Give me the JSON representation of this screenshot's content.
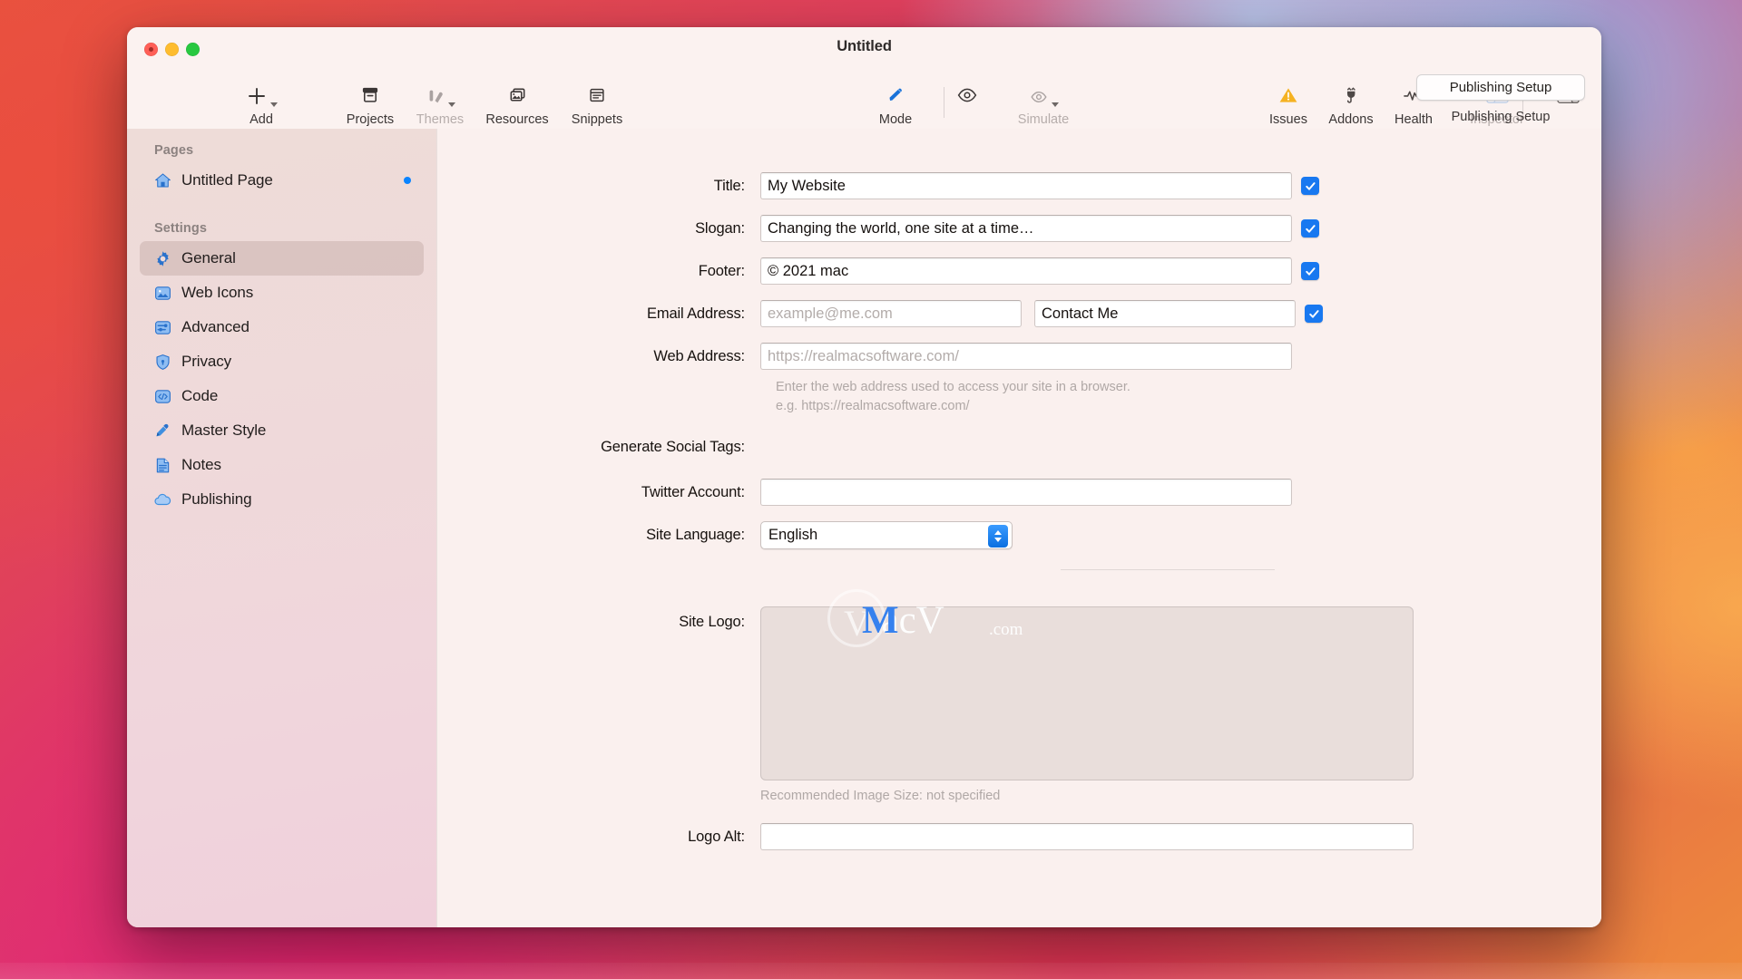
{
  "window": {
    "title": "Untitled",
    "traffic_lights": [
      "close",
      "minimize",
      "zoom"
    ]
  },
  "toolbar": {
    "left_items": [
      {
        "label": "Add",
        "icon": "plus-icon",
        "enabled": true,
        "has_caret": true
      },
      {
        "label": "Projects",
        "icon": "archive-icon",
        "enabled": true,
        "has_caret": false
      },
      {
        "label": "Themes",
        "icon": "themes-icon",
        "enabled": false,
        "has_caret": true
      },
      {
        "label": "Resources",
        "icon": "images-icon",
        "enabled": true,
        "has_caret": false
      },
      {
        "label": "Snippets",
        "icon": "snippets-icon",
        "enabled": true,
        "has_caret": false
      }
    ],
    "center_items": [
      {
        "label": "Mode",
        "icon": "pencil-icon",
        "enabled": true,
        "has_caret": false
      },
      {
        "label": "",
        "icon": "preview-eye-icon",
        "enabled": true,
        "has_caret": false
      },
      {
        "label": "Simulate",
        "icon": "simulate-icon",
        "enabled": false,
        "has_caret": true
      }
    ],
    "right_items": [
      {
        "label": "Issues",
        "icon": "warning-triangle-icon",
        "enabled": true
      },
      {
        "label": "Addons",
        "icon": "plug-icon",
        "enabled": true
      },
      {
        "label": "Health",
        "icon": "pulse-icon",
        "enabled": true
      },
      {
        "label": "Inspector",
        "icon": "sidebar-left-icon",
        "enabled": false
      }
    ],
    "split_view_icon": "split-view-icon",
    "publishing_button_label": "Publishing Setup",
    "publishing_caption": "Publishing Setup"
  },
  "sidebar": {
    "sections": [
      {
        "header": "Pages",
        "items": [
          {
            "label": "Untitled Page",
            "icon": "home-icon",
            "selected": false,
            "dot": true
          }
        ]
      },
      {
        "header": "Settings",
        "items": [
          {
            "label": "General",
            "icon": "gear-icon",
            "selected": true,
            "dot": false
          },
          {
            "label": "Web Icons",
            "icon": "photo-icon",
            "selected": false,
            "dot": false
          },
          {
            "label": "Advanced",
            "icon": "sliders-icon",
            "selected": false,
            "dot": false
          },
          {
            "label": "Privacy",
            "icon": "shield-icon",
            "selected": false,
            "dot": false
          },
          {
            "label": "Code",
            "icon": "code-icon",
            "selected": false,
            "dot": false
          },
          {
            "label": "Master Style",
            "icon": "eyedropper-icon",
            "selected": false,
            "dot": false
          },
          {
            "label": "Notes",
            "icon": "note-icon",
            "selected": false,
            "dot": false
          },
          {
            "label": "Publishing",
            "icon": "cloud-icon",
            "selected": false,
            "dot": false
          }
        ]
      }
    ]
  },
  "form": {
    "title": {
      "label": "Title:",
      "value": "My Website",
      "checked": true
    },
    "slogan": {
      "label": "Slogan:",
      "value": "Changing the world, one site at a time…",
      "checked": true
    },
    "footer": {
      "label": "Footer:",
      "value": "© 2021 mac",
      "checked": true
    },
    "email": {
      "label": "Email Address:",
      "value": "",
      "placeholder": "example@me.com",
      "link_text": "Contact Me",
      "checked": true
    },
    "web_address": {
      "label": "Web Address:",
      "value": "",
      "placeholder": "https://realmacsoftware.com/",
      "hint_line1": "Enter the web address used to access your site in a browser.",
      "hint_line2": "e.g. https://realmacsoftware.com/"
    },
    "social_tags": {
      "label": "Generate Social Tags:"
    },
    "twitter": {
      "label": "Twitter Account:",
      "value": ""
    },
    "site_language": {
      "label": "Site Language:",
      "value": "English",
      "options": [
        "English"
      ]
    },
    "site_logo": {
      "label": "Site Logo:",
      "hint": "Recommended Image Size: not specified"
    },
    "logo_alt": {
      "label": "Logo Alt:",
      "value": ""
    }
  },
  "watermark": {
    "m": "M",
    "rest": "acV",
    "com": ".com"
  },
  "colors": {
    "accent_blue": "#0a84ff",
    "checkbox_blue": "#1878f0",
    "warning_yellow": "#f5b222",
    "window_bg": "#faf0ee",
    "sidebar_bg": "#eedcd8"
  }
}
